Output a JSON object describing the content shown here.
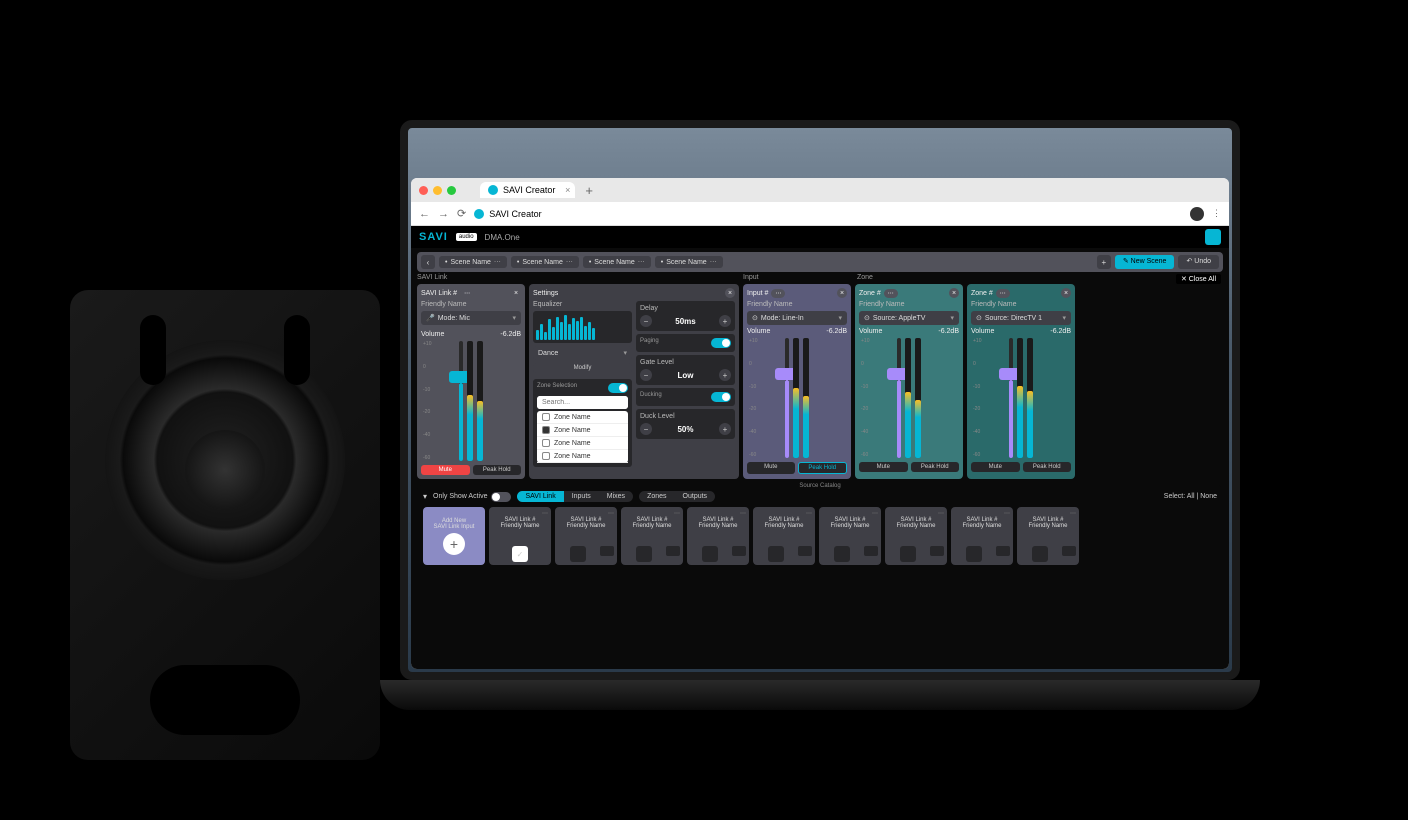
{
  "browser": {
    "tab_title": "SAVI Creator",
    "url_title": "SAVI Creator"
  },
  "app": {
    "logo_text": "SAVI",
    "logo_badge": "audio",
    "title": "DMA.One"
  },
  "scenes": {
    "items": [
      "Scene Name",
      "Scene Name",
      "Scene Name",
      "Scene Name"
    ],
    "new_label": "New Scene",
    "undo_label": "Undo"
  },
  "sections": {
    "savi_label": "SAVI Link",
    "input_label": "Input",
    "zone_label": "Zone",
    "close_all": "Close All"
  },
  "savi_panel": {
    "title": "SAVI Link #",
    "subtitle": "Friendly Name",
    "mode": "Mode: Mic",
    "vol_label": "Volume",
    "vol_value": "-6.2dB",
    "mute": "Mute",
    "peak": "Peak Hold"
  },
  "settings": {
    "title": "Settings",
    "eq_label": "Equalizer",
    "preset": "Dance",
    "modify": "Modify",
    "delay_label": "Delay",
    "delay_value": "50ms",
    "paging": "Paging",
    "gate": "Gate Level",
    "gate_value": "Low",
    "zone_sel": "Zone Selection",
    "search_ph": "Search...",
    "zones": [
      "Zone Name",
      "Zone Name",
      "Zone Name",
      "Zone Name"
    ],
    "ducking": "Ducking",
    "duck_level": "Duck Level",
    "duck_value": "50%"
  },
  "input_panel": {
    "title": "Input #",
    "subtitle": "Friendly Name",
    "mode": "Mode: Line-In",
    "vol_label": "Volume",
    "vol_value": "-6.2dB",
    "mute": "Mute",
    "peak": "Peak Hold"
  },
  "zone1": {
    "title": "Zone #",
    "subtitle": "Friendly Name",
    "source": "Source: AppleTV",
    "vol_label": "Volume",
    "vol_value": "-6.2dB",
    "mute": "Mute",
    "peak": "Peak Hold"
  },
  "zone2": {
    "title": "Zone #",
    "subtitle": "Friendly Name",
    "source": "Source: DirecTV 1",
    "vol_label": "Volume",
    "vol_value": "-6.2dB",
    "mute": "Mute",
    "peak": "Peak Hold"
  },
  "catalog": {
    "label": "Source Catalog",
    "only_active": "Only Show Active",
    "tabs": [
      "SAVI Link",
      "Inputs",
      "Mixes"
    ],
    "tabs2": [
      "Zones",
      "Outputs"
    ],
    "select": "Select:",
    "all_none": "All | None",
    "add_new": "Add New",
    "add_sub": "SAVI Link Input",
    "card_title": "SAVI Link #",
    "card_sub": "Friendly Name"
  }
}
